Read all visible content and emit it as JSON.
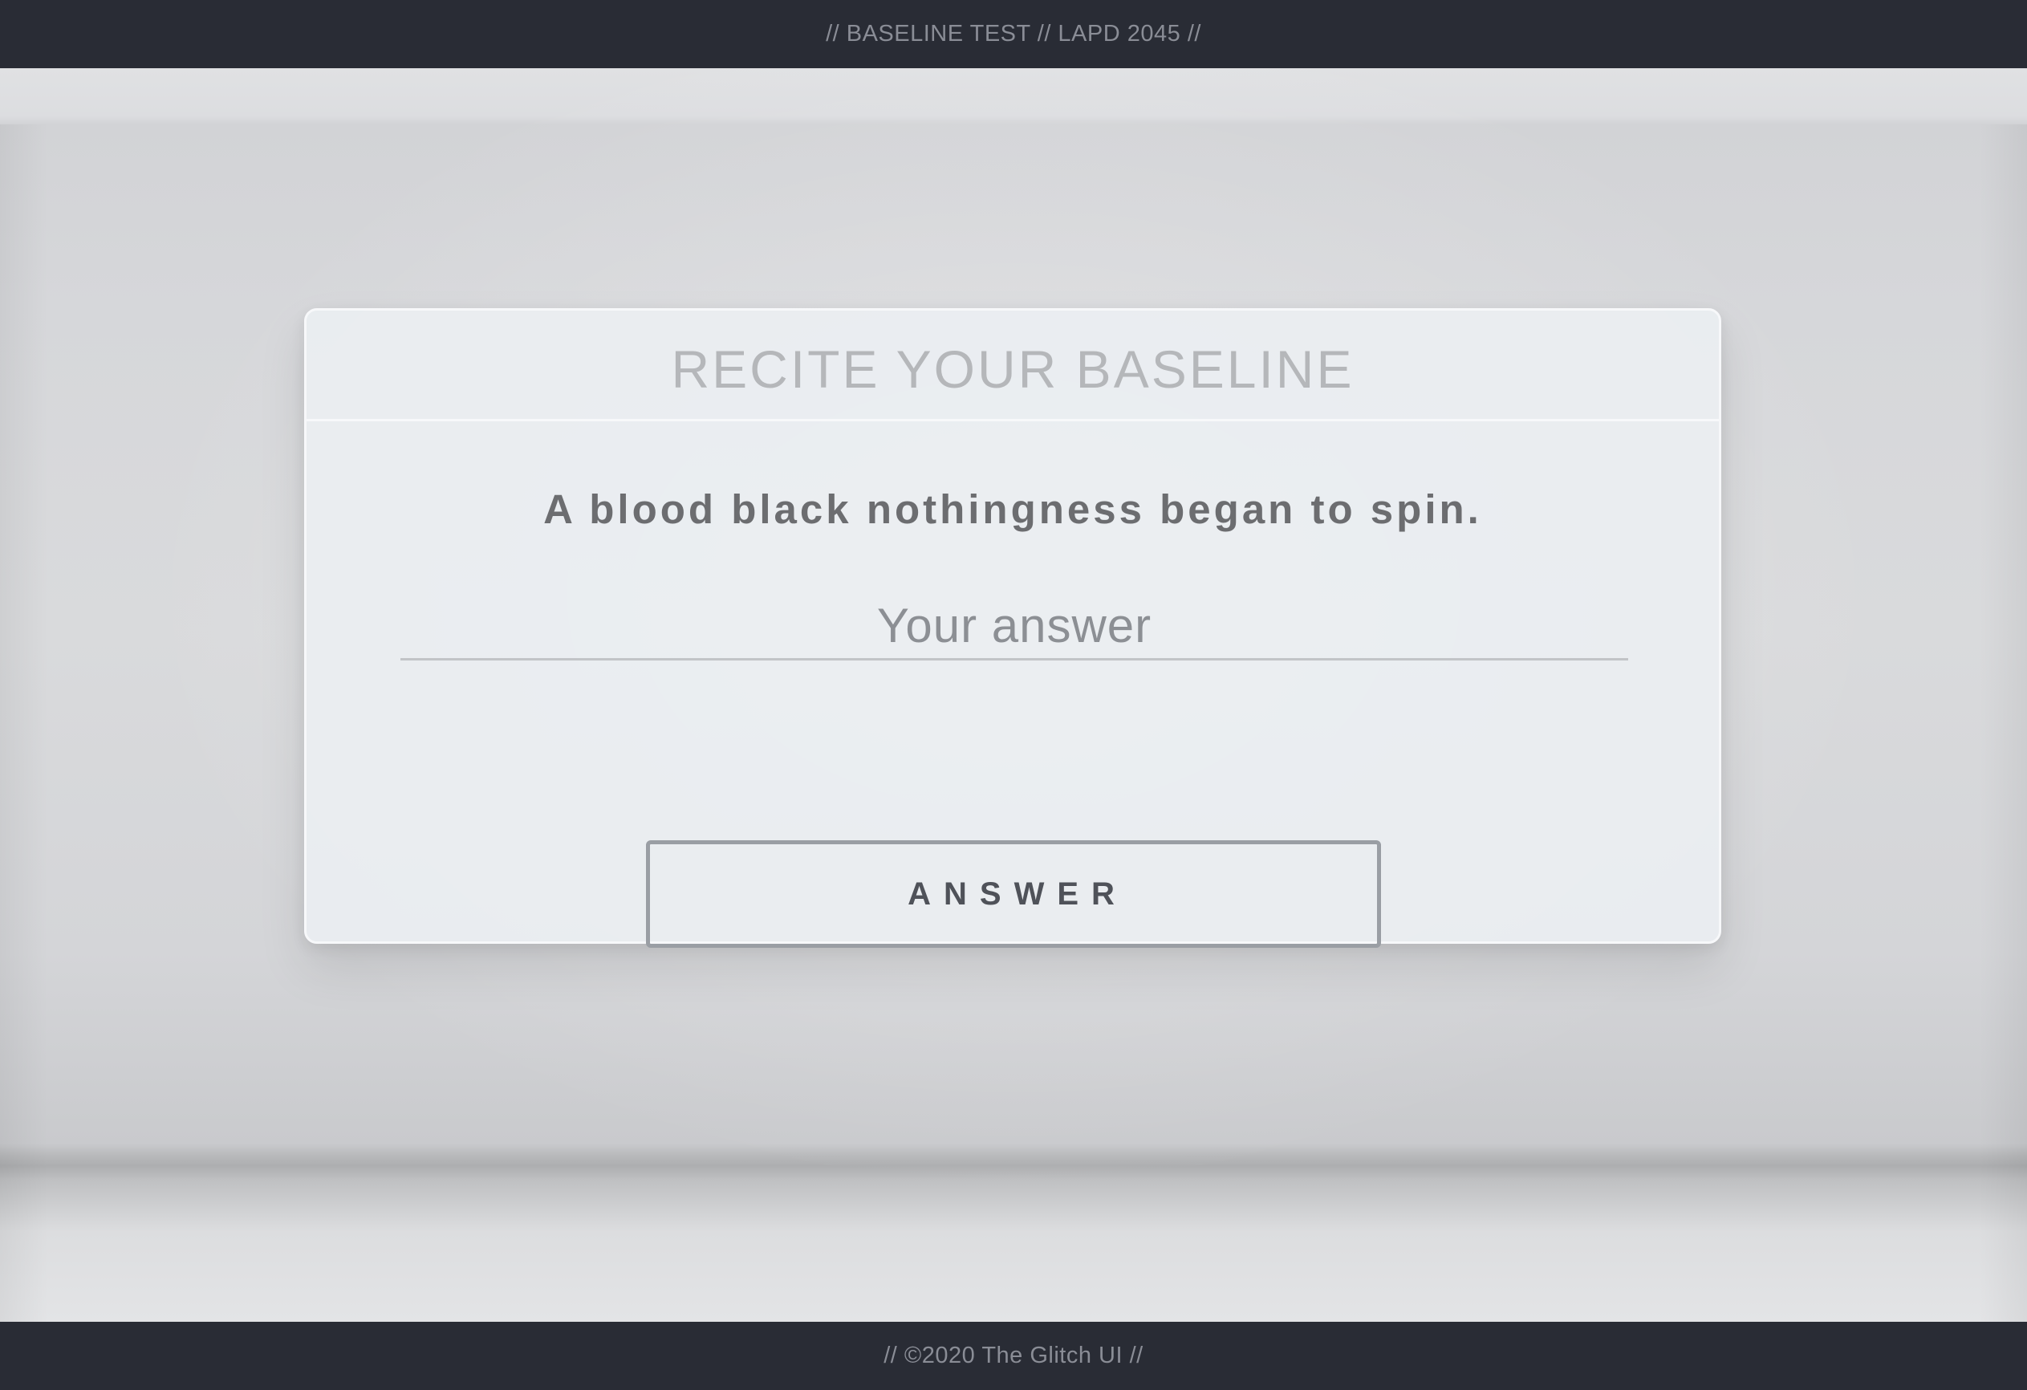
{
  "header": {
    "text": "// BASELINE TEST // LAPD 2045 //"
  },
  "card": {
    "title": "RECITE YOUR BASELINE",
    "statement": "A blood black nothingness began to spin.",
    "input": {
      "placeholder": "Your answer",
      "value": ""
    },
    "button_label": "ANSWER"
  },
  "footer": {
    "text": "// ©2020 The Glitch UI //"
  }
}
